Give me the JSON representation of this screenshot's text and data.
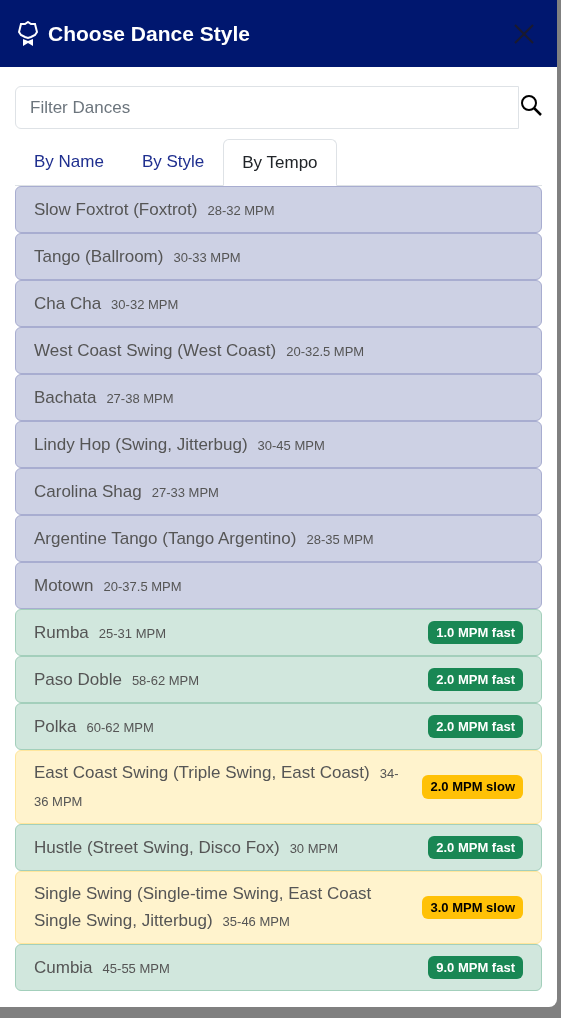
{
  "dialog": {
    "title": "Choose Dance Style"
  },
  "search": {
    "placeholder": "Filter Dances"
  },
  "tabs": [
    {
      "label": "By Name",
      "selected": false
    },
    {
      "label": "By Style",
      "selected": false
    },
    {
      "label": "By Tempo",
      "selected": true
    }
  ],
  "dances": [
    {
      "kind": "match",
      "name": "Slow Foxtrot (Foxtrot)",
      "tempo": "28-32 MPM"
    },
    {
      "kind": "match",
      "name": "Tango (Ballroom)",
      "tempo": "30-33 MPM"
    },
    {
      "kind": "match",
      "name": "Cha Cha",
      "tempo": "30-32 MPM"
    },
    {
      "kind": "match",
      "name": "West Coast Swing (West Coast)",
      "tempo": "20-32.5 MPM"
    },
    {
      "kind": "match",
      "name": "Bachata",
      "tempo": "27-38 MPM"
    },
    {
      "kind": "match",
      "name": "Lindy Hop (Swing, Jitterbug)",
      "tempo": "30-45 MPM"
    },
    {
      "kind": "match",
      "name": "Carolina Shag",
      "tempo": "27-33 MPM"
    },
    {
      "kind": "match",
      "name": "Argentine Tango (Tango Argentino)",
      "tempo": "28-35 MPM"
    },
    {
      "kind": "match",
      "name": "Motown",
      "tempo": "20-37.5 MPM"
    },
    {
      "kind": "fast",
      "name": "Rumba",
      "tempo": "25-31 MPM",
      "badge": "1.0 MPM fast"
    },
    {
      "kind": "fast",
      "name": "Paso Doble",
      "tempo": "58-62 MPM",
      "badge": "2.0 MPM fast"
    },
    {
      "kind": "fast",
      "name": "Polka",
      "tempo": "60-62 MPM",
      "badge": "2.0 MPM fast"
    },
    {
      "kind": "slow",
      "name": "East Coast Swing (Triple Swing, East Coast)",
      "tempo": "34-36 MPM",
      "badge": "2.0 MPM slow"
    },
    {
      "kind": "fast",
      "name": "Hustle (Street Swing, Disco Fox)",
      "tempo": "30 MPM",
      "badge": "2.0 MPM fast"
    },
    {
      "kind": "slow",
      "name": "Single Swing (Single-time Swing, East Coast Single Swing, Jitterbug)",
      "tempo": "35-46 MPM",
      "badge": "3.0 MPM slow"
    },
    {
      "kind": "fast",
      "name": "Cumbia",
      "tempo": "45-55 MPM",
      "badge": "9.0 MPM fast"
    }
  ]
}
